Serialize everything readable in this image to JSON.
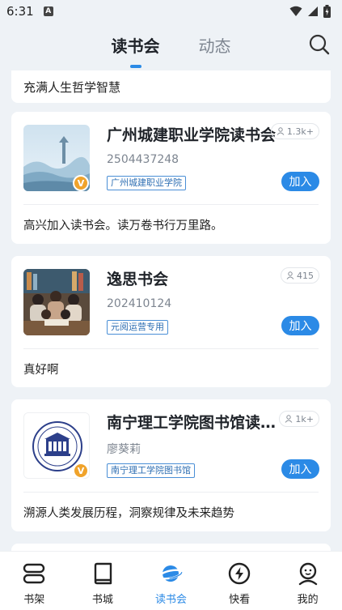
{
  "status_bar": {
    "time": "6:31",
    "notification_letter": "A"
  },
  "header": {
    "tabs": [
      {
        "label": "读书会",
        "active": true
      },
      {
        "label": "动态",
        "active": false
      }
    ],
    "search_icon": "search-icon"
  },
  "feed": {
    "partial_top_desc": "充满人生哲学智慧",
    "clubs": [
      {
        "name": "广州城建职业学院读书会",
        "id": "2504437248",
        "tag": "广州城建职业学院",
        "members": "1.3k+",
        "verified": "V",
        "join_label": "加入",
        "description": "高兴加入读书会。读万卷书行万里路。"
      },
      {
        "name": "逸思书会",
        "id": "202410124",
        "tag": "元阅运营专用",
        "members": "415",
        "verified": "",
        "join_label": "加入",
        "description": "真好啊"
      },
      {
        "name": "南宁理工学院图书馆读…",
        "id": "廖葵莉",
        "tag": "南宁理工学院图书馆",
        "members": "1k+",
        "verified": "V",
        "join_label": "加入",
        "description": "溯源人类发展历程，洞察规律及未来趋势"
      }
    ]
  },
  "tabbar": {
    "items": [
      {
        "label": "书架",
        "icon": "bookshelf-icon",
        "active": false
      },
      {
        "label": "书城",
        "icon": "book-icon",
        "active": false
      },
      {
        "label": "读书会",
        "icon": "planet-icon",
        "active": true
      },
      {
        "label": "快看",
        "icon": "lightning-icon",
        "active": false
      },
      {
        "label": "我的",
        "icon": "profile-icon",
        "active": false
      }
    ]
  },
  "colors": {
    "accent": "#2b8ae6",
    "verified_badge": "#f0a32b",
    "background": "#eef2f6"
  }
}
